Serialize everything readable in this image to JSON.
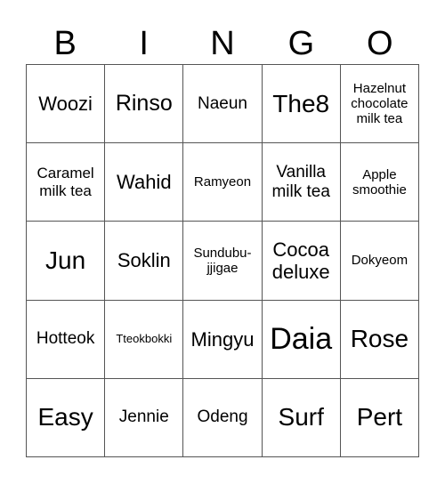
{
  "header": {
    "letters": [
      "B",
      "I",
      "N",
      "G",
      "O"
    ]
  },
  "grid": {
    "rows": [
      [
        "Woozi",
        "Rinso",
        "Naeun",
        "The8",
        "Hazelnut chocolate milk tea"
      ],
      [
        "Caramel milk tea",
        "Wahid",
        "Ramyeon",
        "Vanilla milk tea",
        "Apple smoothie"
      ],
      [
        "Jun",
        "Soklin",
        "Sundubu-jjigae",
        "Cocoa deluxe",
        "Dokyeom"
      ],
      [
        "Hotteok",
        "Tteokbokki",
        "Mingyu",
        "Daia",
        "Rose"
      ],
      [
        "Easy",
        "Jennie",
        "Odeng",
        "Surf",
        "Pert"
      ]
    ]
  }
}
